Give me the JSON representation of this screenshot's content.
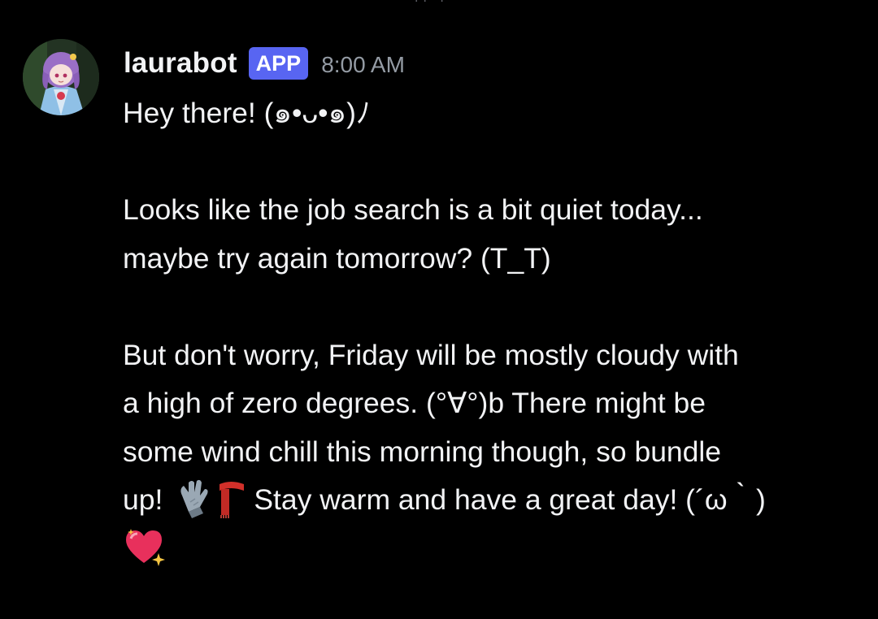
{
  "message": {
    "author": "laurabot",
    "badge": "APP",
    "timestamp": "8:00 AM",
    "avatar_icon": "anime-character-avatar",
    "lines": {
      "l1": "Hey there!  (๑•ᴗ•๑)ﾉ",
      "l2": "Looks like the job search is a bit quiet today...",
      "l3": "maybe try again tomorrow? (T_T)",
      "l4": "But don't worry, Friday will be mostly cloudy with",
      "l5": "a high of zero degrees. (°∀°)b There might be",
      "l6": "some wind chill this morning though, so bundle",
      "l7_start": "up!",
      "l7_end": "Stay warm and have a great day! (´ω｀)"
    },
    "emojis": [
      "gloves-emoji",
      "scarf-emoji",
      "sparkling-heart-emoji"
    ]
  },
  "colors": {
    "background": "#000000",
    "text": "#f2f3f5",
    "timestamp": "#949ba4",
    "badge": "#5865f2"
  }
}
